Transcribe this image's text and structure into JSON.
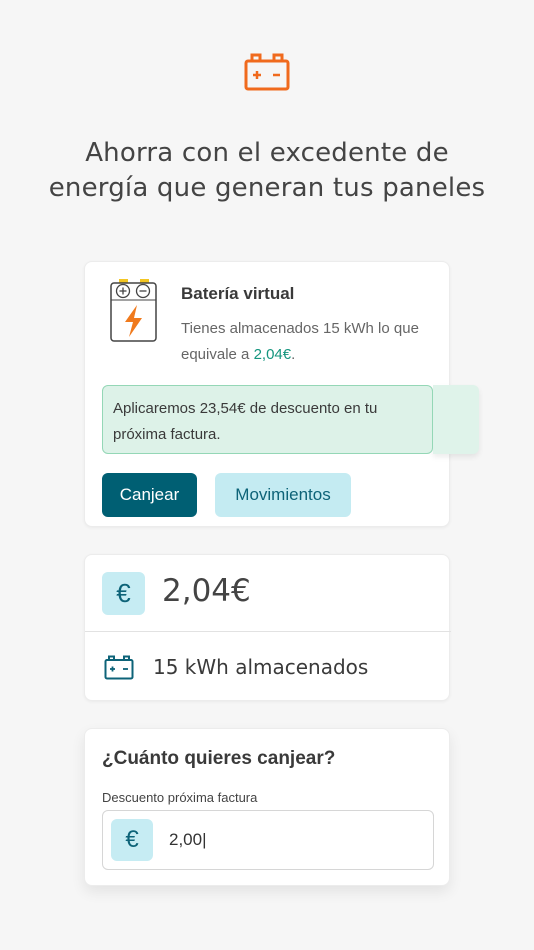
{
  "header": {
    "icon": "battery-icon",
    "headline_line1": "Ahorra con el excedente de",
    "headline_line2": "energía que generan tus paneles"
  },
  "battery_card": {
    "icon": "battery-lightning-icon",
    "title": "Batería virtual",
    "desc_prefix": "Tienes almacenados 15 kWh lo que equivale a ",
    "desc_amount": "2,04€",
    "desc_suffix": ".",
    "notice": "Aplicaremos 23,54€ de descuento en tu próxima factura.",
    "redeem_button": "Canjear",
    "movements_button": "Movimientos"
  },
  "balance_card": {
    "euro_symbol": "€",
    "amount": "2,04€",
    "kwh_icon": "battery-icon",
    "kwh_label": "15 kWh almacenados"
  },
  "redeem_form": {
    "title": "¿Cuánto quieres canjear?",
    "field_label": "Descuento próxima factura",
    "currency_symbol": "€",
    "value": "2,00|"
  },
  "colors": {
    "accent_orange": "#f06a1d",
    "primary_teal": "#005f73",
    "light_teal": "#c4ebf2",
    "success_green": "#14957e",
    "notice_bg": "#ddf2e8"
  }
}
